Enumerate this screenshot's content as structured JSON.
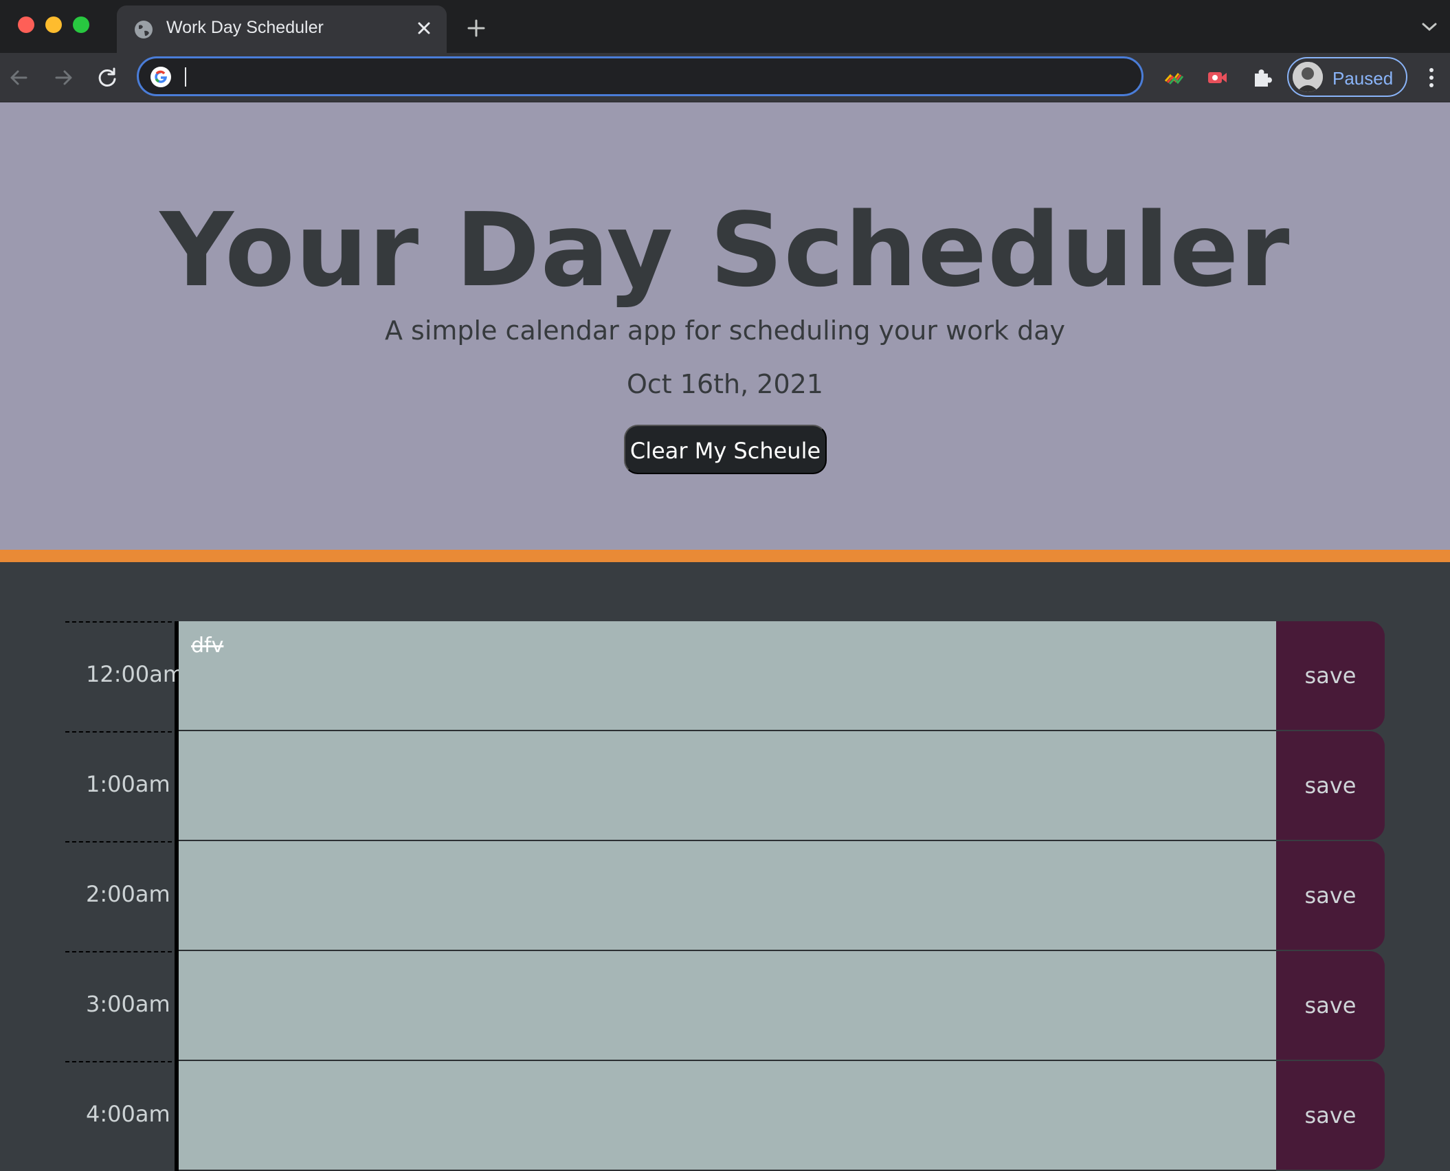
{
  "browser": {
    "tab_title": "Work Day Scheduler",
    "address_value": "",
    "profile_label": "Paused",
    "accent_color": "#8ab4f8"
  },
  "header": {
    "title": "Your Day Scheduler",
    "subtitle": "A simple calendar app for scheduling your work day",
    "date": "Oct 16th, 2021",
    "clear_button": "Clear My Scheule",
    "background_color": "#9c9aaf",
    "divider_color": "#e98a36"
  },
  "schedule": {
    "save_label": "save",
    "save_color": "#481a38",
    "entry_color": "#a6b6b6",
    "rows": [
      {
        "hour": "12:00am",
        "text": "dfv"
      },
      {
        "hour": "1:00am",
        "text": ""
      },
      {
        "hour": "2:00am",
        "text": ""
      },
      {
        "hour": "3:00am",
        "text": ""
      },
      {
        "hour": "4:00am",
        "text": ""
      }
    ]
  }
}
